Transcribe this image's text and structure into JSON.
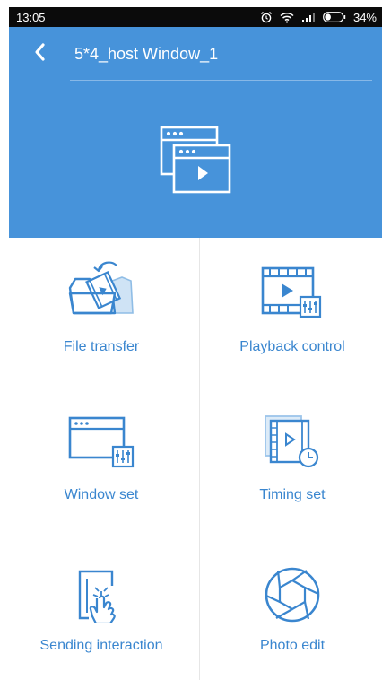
{
  "status_bar": {
    "time": "13:05",
    "battery": "34%"
  },
  "header": {
    "title": "5*4_host Window_1"
  },
  "tiles": [
    {
      "label": "File transfer",
      "icon": "file-transfer-icon"
    },
    {
      "label": "Playback control",
      "icon": "playback-control-icon"
    },
    {
      "label": "Window set",
      "icon": "window-set-icon"
    },
    {
      "label": "Timing set",
      "icon": "timing-set-icon"
    },
    {
      "label": "Sending interaction",
      "icon": "sending-interaction-icon"
    },
    {
      "label": "Photo edit",
      "icon": "photo-edit-icon"
    }
  ],
  "colors": {
    "header_bg": "#4793da",
    "accent": "#3a86cf",
    "status_bg": "#0b0b0b"
  }
}
